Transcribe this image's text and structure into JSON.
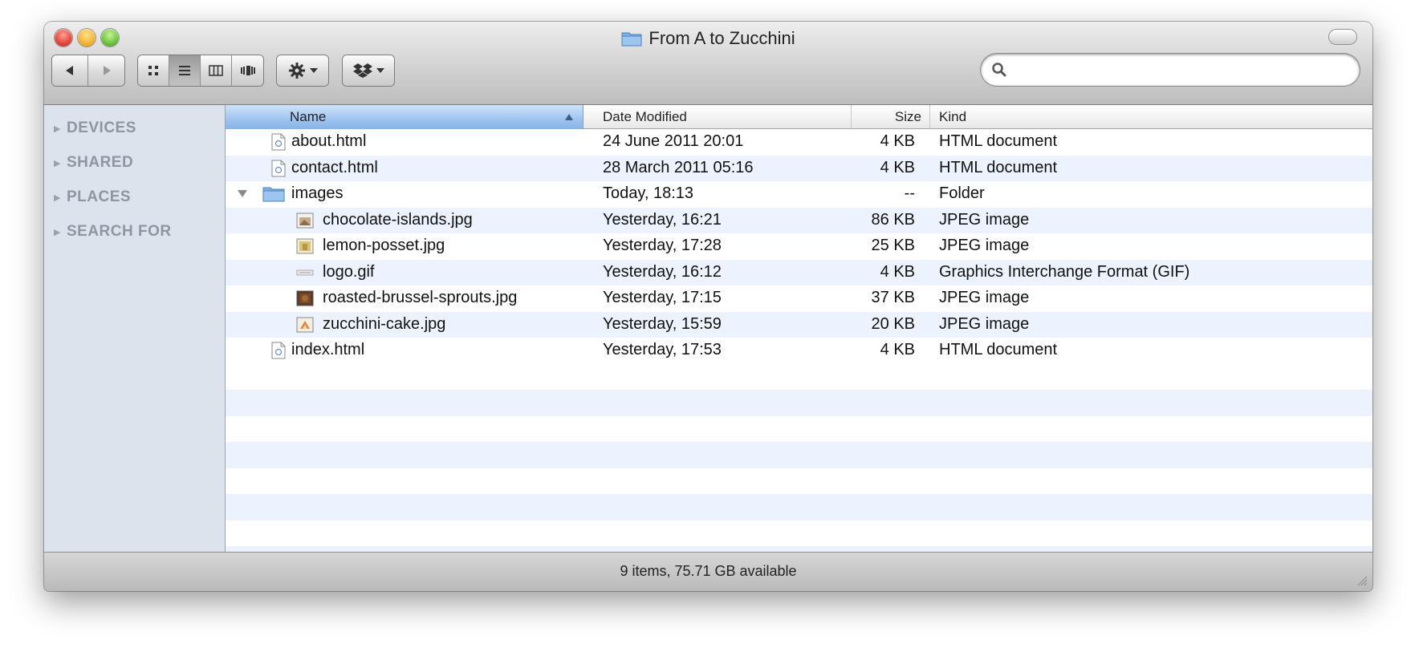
{
  "window": {
    "title": "From A to Zucchini"
  },
  "toolbar": {
    "back_icon": "back-arrow-icon",
    "forward_icon": "forward-arrow-icon",
    "views": [
      "icon-view-icon",
      "list-view-icon",
      "column-view-icon",
      "coverflow-view-icon"
    ],
    "active_view": "list",
    "action_icon": "gear-icon",
    "dropbox_icon": "dropbox-icon",
    "search_placeholder": ""
  },
  "sidebar": {
    "sections": [
      {
        "label": "DEVICES"
      },
      {
        "label": "SHARED"
      },
      {
        "label": "PLACES"
      },
      {
        "label": "SEARCH FOR"
      }
    ]
  },
  "columns": {
    "name": "Name",
    "date": "Date Modified",
    "size": "Size",
    "kind": "Kind",
    "sorted_by": "Name"
  },
  "files": [
    {
      "name": "about.html",
      "date": "24 June 2011 20:01",
      "size": "4 KB",
      "kind": "HTML document",
      "icon": "html-file-icon",
      "level": 0
    },
    {
      "name": "contact.html",
      "date": "28 March 2011 05:16",
      "size": "4 KB",
      "kind": "HTML document",
      "icon": "html-file-icon",
      "level": 0
    },
    {
      "name": "images",
      "date": "Today, 18:13",
      "size": "--",
      "kind": "Folder",
      "icon": "folder-icon",
      "level": 0,
      "expanded": true
    },
    {
      "name": "chocolate-islands.jpg",
      "date": "Yesterday, 16:21",
      "size": "86 KB",
      "kind": "JPEG image",
      "icon": "jpeg-thumbnail-icon",
      "level": 1
    },
    {
      "name": "lemon-posset.jpg",
      "date": "Yesterday, 17:28",
      "size": "25 KB",
      "kind": "JPEG image",
      "icon": "jpeg-thumbnail-icon",
      "level": 1
    },
    {
      "name": "logo.gif",
      "date": "Yesterday, 16:12",
      "size": "4 KB",
      "kind": "Graphics Interchange Format (GIF)",
      "icon": "gif-thumbnail-icon",
      "level": 1
    },
    {
      "name": "roasted-brussel-sprouts.jpg",
      "date": "Yesterday, 17:15",
      "size": "37 KB",
      "kind": "JPEG image",
      "icon": "jpeg-thumbnail-icon",
      "level": 1
    },
    {
      "name": "zucchini-cake.jpg",
      "date": "Yesterday, 15:59",
      "size": "20 KB",
      "kind": "JPEG image",
      "icon": "jpeg-thumbnail-icon",
      "level": 1
    },
    {
      "name": "index.html",
      "date": "Yesterday, 17:53",
      "size": "4 KB",
      "kind": "HTML document",
      "icon": "html-file-icon",
      "level": 0
    }
  ],
  "status": {
    "text": "9 items, 75.71 GB available"
  },
  "colors": {
    "sidebar_bg": "#dde3ec",
    "row_stripe": "#edf3fe",
    "sort_header": "#9ec4ee"
  }
}
